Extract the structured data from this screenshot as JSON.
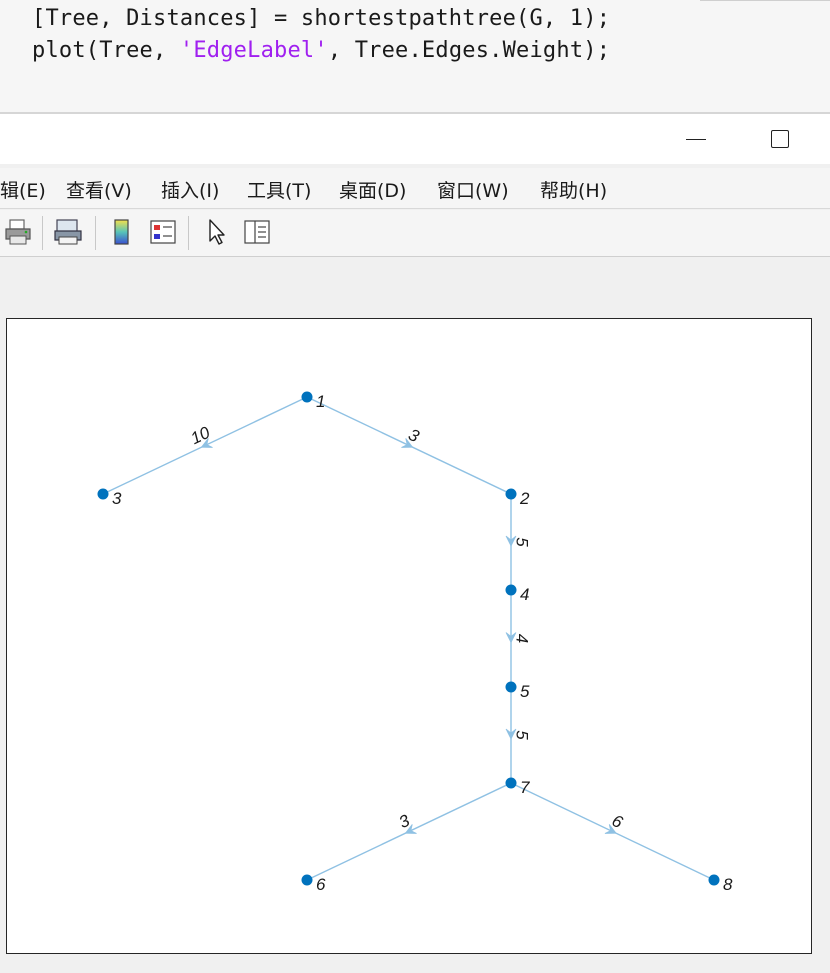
{
  "editor": {
    "line1": "[Tree, Distances] = shortestpathtree(G, 1);",
    "line2_pre": "plot(Tree, ",
    "line2_str": "'EdgeLabel'",
    "line2_post": ", Tree.Edges.Weight);"
  },
  "window": {
    "minimize_label": "—",
    "maximize_label": "☐"
  },
  "menu": {
    "items": [
      "辑(E)",
      "查看(V)",
      "插入(I)",
      "工具(T)",
      "桌面(D)",
      "窗口(W)",
      "帮助(H)"
    ]
  },
  "toolbar": {
    "icons": [
      "print-icon",
      "print-preview-icon",
      "colorbar-icon",
      "legend-icon",
      "pointer-icon",
      "property-editor-icon"
    ]
  },
  "graph": {
    "node_color": "#0072bd",
    "edge_color": "#8fc1e3",
    "nodes": [
      {
        "id": "1",
        "label": "1"
      },
      {
        "id": "2",
        "label": "2"
      },
      {
        "id": "3",
        "label": "3"
      },
      {
        "id": "4",
        "label": "4"
      },
      {
        "id": "5",
        "label": "5"
      },
      {
        "id": "6",
        "label": "6"
      },
      {
        "id": "7",
        "label": "7"
      },
      {
        "id": "8",
        "label": "8"
      }
    ],
    "edges": [
      {
        "from": "1",
        "to": "3",
        "weight": "10"
      },
      {
        "from": "1",
        "to": "2",
        "weight": "3"
      },
      {
        "from": "2",
        "to": "4",
        "weight": "5"
      },
      {
        "from": "4",
        "to": "5",
        "weight": "4"
      },
      {
        "from": "5",
        "to": "7",
        "weight": "5"
      },
      {
        "from": "7",
        "to": "6",
        "weight": "3"
      },
      {
        "from": "7",
        "to": "8",
        "weight": "6"
      }
    ]
  }
}
